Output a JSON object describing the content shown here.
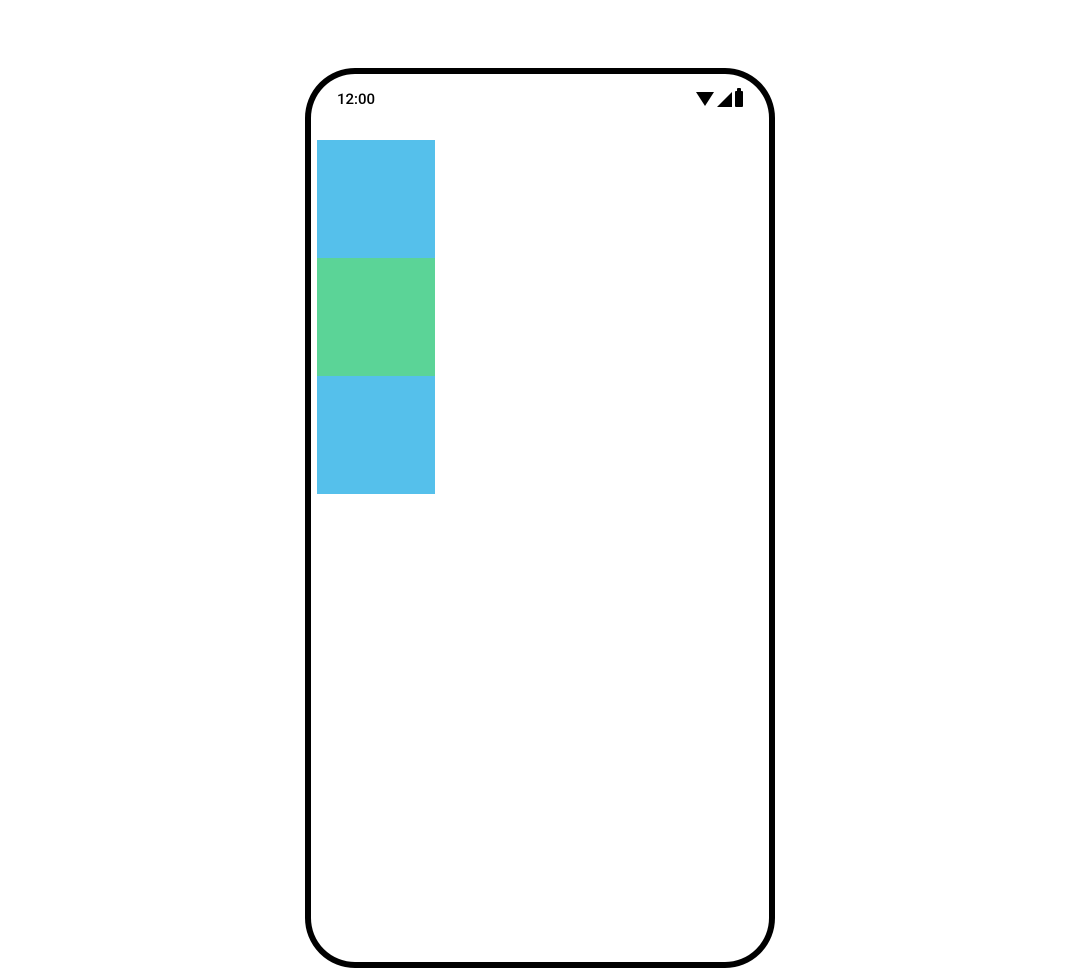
{
  "status_bar": {
    "time": "12:00"
  },
  "blocks": {
    "top_color": "#55c0eb",
    "middle_color": "#5bd497",
    "bottom_color": "#55c0eb"
  }
}
